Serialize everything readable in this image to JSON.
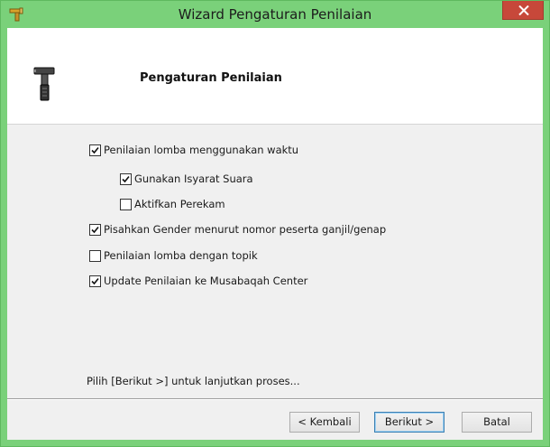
{
  "window": {
    "title": "Wizard Pengaturan Penilaian",
    "accent_color": "#7ad17a",
    "close_color": "#c7483a"
  },
  "header": {
    "title": "Pengaturan Penilaian",
    "icon": "hammer-icon"
  },
  "options": [
    {
      "label": "Penilaian lomba menggunakan waktu",
      "checked": true
    },
    {
      "label": "Gunakan Isyarat Suara",
      "checked": true
    },
    {
      "label": "Aktifkan Perekam",
      "checked": false
    },
    {
      "label": "Pisahkan Gender menurut nomor peserta ganjil/genap",
      "checked": true
    },
    {
      "label": "Penilaian lomba dengan topik",
      "checked": false
    },
    {
      "label": "Update Penilaian ke Musabaqah Center",
      "checked": true
    }
  ],
  "hint": "Pilih [Berikut >] untuk lanjutkan proses...",
  "buttons": {
    "back": "< Kembali",
    "next": "Berikut >",
    "cancel": "Batal"
  }
}
